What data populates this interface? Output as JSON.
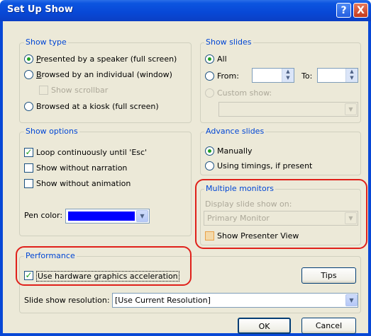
{
  "window": {
    "title": "Set Up Show",
    "help_glyph": "?",
    "close_glyph": "X"
  },
  "show_type": {
    "legend": "Show type",
    "options": [
      {
        "label": "Presented by a speaker (full screen)",
        "selected": true
      },
      {
        "label": "Browsed by an individual (window)",
        "selected": false
      },
      {
        "label": "Browsed at a kiosk (full screen)",
        "selected": false
      }
    ],
    "scrollbar_label": "Show scrollbar"
  },
  "show_slides": {
    "legend": "Show slides",
    "all_label": "All",
    "from_label": "From:",
    "to_label": "To:",
    "from_value": "",
    "to_value": "",
    "custom_label": "Custom show:",
    "custom_value": ""
  },
  "show_options": {
    "legend": "Show options",
    "loop_label": "Loop continuously until 'Esc'",
    "loop_checked": true,
    "narration_label": "Show without narration",
    "narration_checked": false,
    "animation_label": "Show without animation",
    "animation_checked": false,
    "pen_label": "Pen color:",
    "pen_color": "#0000ff"
  },
  "advance_slides": {
    "legend": "Advance slides",
    "manual_label": "Manually",
    "timings_label": "Using timings, if present",
    "selected": "manual"
  },
  "multiple_monitors": {
    "legend": "Multiple monitors",
    "display_label": "Display slide show on:",
    "display_value": "Primary Monitor",
    "presenter_label": "Show Presenter View",
    "presenter_checked": false
  },
  "performance": {
    "legend": "Performance",
    "hw_label": "Use hardware graphics acceleration",
    "hw_checked": true,
    "tips_label": "Tips",
    "resolution_label": "Slide show resolution:",
    "resolution_value": "[Use Current Resolution]"
  },
  "footer": {
    "ok_label": "OK",
    "cancel_label": "Cancel"
  },
  "colors": {
    "title_bar": "#0848d6",
    "legend_text": "#0046d5",
    "highlight": "#e0201a",
    "dialog_bg": "#ece9d8"
  }
}
